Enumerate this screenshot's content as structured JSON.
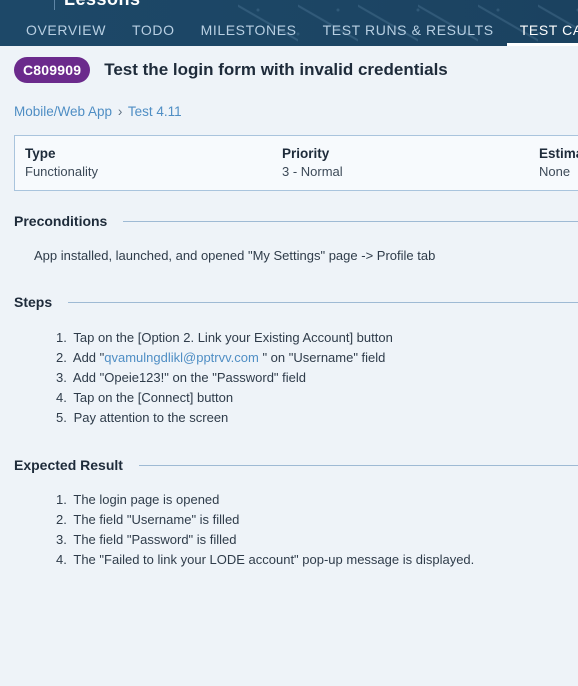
{
  "header": {
    "project_name": "Lessons",
    "tabs": [
      {
        "label": "OVERVIEW"
      },
      {
        "label": "TODO"
      },
      {
        "label": "MILESTONES"
      },
      {
        "label": "TEST RUNS & RESULTS"
      },
      {
        "label": "TEST CASES"
      }
    ],
    "active_tab": "TEST CASES"
  },
  "case": {
    "id": "C809909",
    "title": "Test the login form with invalid credentials"
  },
  "breadcrumb": [
    "Mobile/Web App",
    "Test 4.11"
  ],
  "breadcrumb_separator": "›",
  "fields": [
    {
      "label": "Type",
      "value": "Functionality"
    },
    {
      "label": "Priority",
      "value": "3 - Normal"
    },
    {
      "label": "Estimate",
      "value": "None"
    }
  ],
  "preconditions": {
    "heading": "Preconditions",
    "text": "App installed, launched, and opened \"My Settings\" page -> Profile tab"
  },
  "steps": {
    "heading": "Steps",
    "items": [
      {
        "num": "1.",
        "text": "Tap on the [Option 2. Link your Existing Account] button"
      },
      {
        "num": "2.",
        "pre": "Add \"",
        "link": "qvamulngdlikl@pptrvv.com",
        "post": " \" on \"Username\" field"
      },
      {
        "num": "3.",
        "text": "Add \"Opeie123!\" on the \"Password\" field"
      },
      {
        "num": "4.",
        "text": "Tap on the [Connect] button"
      },
      {
        "num": "5.",
        "text": "Pay attention to the screen"
      }
    ]
  },
  "expected": {
    "heading": "Expected Result",
    "items": [
      {
        "num": "1.",
        "text": "The login page is opened"
      },
      {
        "num": "2.",
        "text": "The field \"Username\" is filled"
      },
      {
        "num": "3.",
        "text": "The field \"Password\" is filled"
      },
      {
        "num": "4.",
        "text": "The \"Failed to link your LODE account\" pop-up message is displayed."
      }
    ]
  },
  "colors": {
    "header_bg": "#1d4868",
    "badge_bg": "#6b2a8c",
    "link": "#4f8ec4",
    "page_bg": "#eef3f8"
  }
}
